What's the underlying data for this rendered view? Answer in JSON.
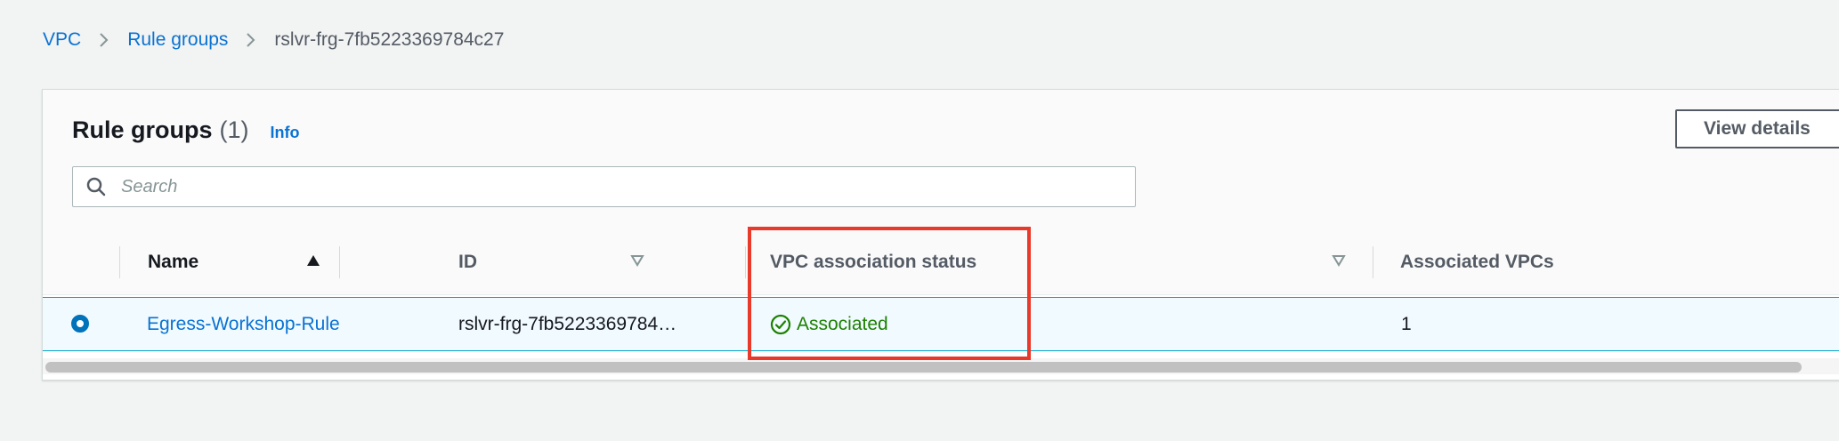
{
  "breadcrumb": {
    "items": [
      {
        "label": "VPC"
      },
      {
        "label": "Rule groups"
      }
    ],
    "current": "rslvr-frg-7fb5223369784c27"
  },
  "panel": {
    "title": "Rule groups",
    "count": "(1)",
    "info_label": "Info",
    "view_details_label": "View details",
    "search": {
      "placeholder": "Search",
      "value": ""
    }
  },
  "table": {
    "columns": {
      "name": "Name",
      "id": "ID",
      "status": "VPC association status",
      "associated_vpcs": "Associated VPCs"
    },
    "sort": {
      "name": "ascending"
    },
    "rows": [
      {
        "selected": true,
        "name": "Egress-Workshop-Rule",
        "id": "rslvr-frg-7fb5223369784…",
        "status": "Associated",
        "status_icon": "check-circle-icon",
        "associated_vpcs": "1"
      }
    ]
  },
  "colors": {
    "link": "#0972d3",
    "success": "#1d8102",
    "selected_row_bg": "#f1faff",
    "selected_row_border": "#00a1c9",
    "highlight": "#e8392a"
  }
}
